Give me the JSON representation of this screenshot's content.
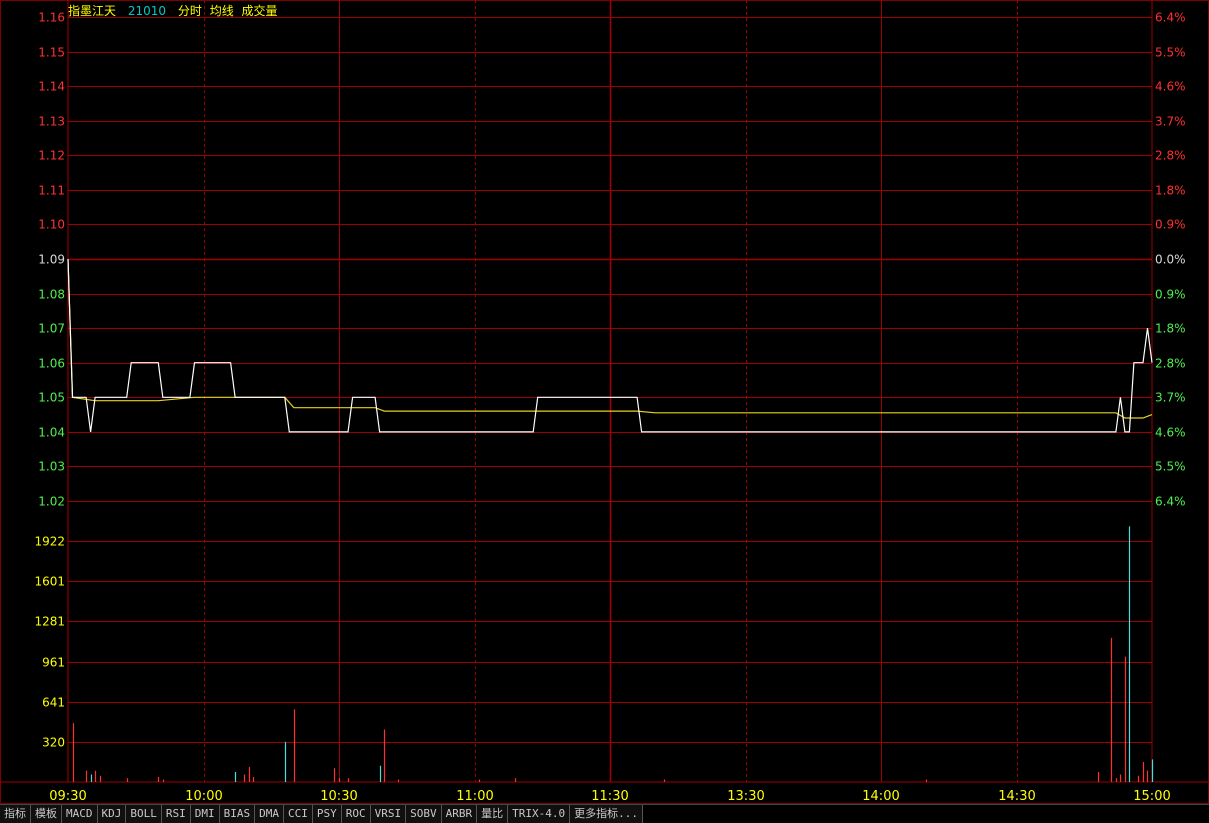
{
  "header": {
    "name": "指墨江天",
    "code": "21010",
    "labels": [
      "分时",
      "均线",
      "成交量"
    ],
    "colors": {
      "name": "#ffff00",
      "code": "#00c8c8",
      "labels": "#ffff00"
    }
  },
  "colors": {
    "background": "#000000",
    "grid": "#a00000",
    "up": "#ff3030",
    "down": "#4ef04e",
    "flat": "#d8d8d8",
    "price_line": "#ffffff",
    "avg_line": "#e6d21e",
    "volume_label": "#ffff00",
    "time_label": "#ffff00",
    "vol_up": "#ff3030",
    "vol_down": "#40e0e0"
  },
  "chart_data": {
    "type": "line",
    "prev_close": 1.09,
    "price_axis": {
      "ticks": [
        1.16,
        1.15,
        1.14,
        1.13,
        1.12,
        1.11,
        1.1,
        1.09,
        1.08,
        1.07,
        1.06,
        1.05,
        1.04,
        1.03,
        1.02
      ],
      "tick_labels": [
        "1.16",
        "1.15",
        "1.14",
        "1.13",
        "1.12",
        "1.11",
        "1.10",
        "1.09",
        "1.08",
        "1.07",
        "1.06",
        "1.05",
        "1.04",
        "1.03",
        "1.02"
      ],
      "ylim": [
        1.02,
        1.16
      ]
    },
    "percent_axis": {
      "tick_labels": [
        "6.4%",
        "5.5%",
        "4.6%",
        "3.7%",
        "2.8%",
        "1.8%",
        "0.9%",
        "0.0%",
        "0.9%",
        "1.8%",
        "2.8%",
        "3.7%",
        "4.6%",
        "5.5%",
        "6.4%"
      ]
    },
    "volume_axis": {
      "tick_labels": [
        "1922",
        "1601",
        "1281",
        "961",
        "641",
        "320"
      ],
      "ticks": [
        1922,
        1601,
        1281,
        961,
        641,
        320
      ],
      "ylim": [
        0,
        2242
      ]
    },
    "time_axis": {
      "tick_labels": [
        "09:30",
        "10:00",
        "10:30",
        "11:00",
        "11:30",
        "13:30",
        "14:00",
        "14:30",
        "15:00"
      ],
      "tick_minutes": [
        0,
        30,
        60,
        90,
        120,
        150,
        180,
        210,
        240
      ],
      "total_minutes": 240
    },
    "series": [
      {
        "key": "price",
        "points": [
          [
            0,
            1.09
          ],
          [
            1,
            1.05
          ],
          [
            4,
            1.05
          ],
          [
            5,
            1.04
          ],
          [
            6,
            1.05
          ],
          [
            13,
            1.05
          ],
          [
            14,
            1.06
          ],
          [
            20,
            1.06
          ],
          [
            21,
            1.05
          ],
          [
            27,
            1.05
          ],
          [
            28,
            1.06
          ],
          [
            36,
            1.06
          ],
          [
            37,
            1.05
          ],
          [
            48,
            1.05
          ],
          [
            49,
            1.04
          ],
          [
            62,
            1.04
          ],
          [
            63,
            1.05
          ],
          [
            68,
            1.05
          ],
          [
            69,
            1.04
          ],
          [
            103,
            1.04
          ],
          [
            104,
            1.05
          ],
          [
            126,
            1.05
          ],
          [
            127,
            1.04
          ],
          [
            232,
            1.04
          ],
          [
            233,
            1.05
          ],
          [
            234,
            1.04
          ],
          [
            235,
            1.04
          ],
          [
            236,
            1.06
          ],
          [
            238,
            1.06
          ],
          [
            239,
            1.07
          ],
          [
            240,
            1.06
          ]
        ]
      },
      {
        "key": "avg",
        "points": [
          [
            0,
            1.09
          ],
          [
            1,
            1.05
          ],
          [
            6,
            1.049
          ],
          [
            20,
            1.049
          ],
          [
            28,
            1.05
          ],
          [
            48,
            1.05
          ],
          [
            50,
            1.047
          ],
          [
            68,
            1.047
          ],
          [
            70,
            1.046
          ],
          [
            104,
            1.046
          ],
          [
            126,
            1.046
          ],
          [
            130,
            1.0455
          ],
          [
            232,
            1.0455
          ],
          [
            234,
            1.044
          ],
          [
            238,
            1.044
          ],
          [
            240,
            1.045
          ]
        ]
      }
    ],
    "volume": [
      [
        1,
        470,
        "up"
      ],
      [
        4,
        90,
        "up"
      ],
      [
        5,
        60,
        "down"
      ],
      [
        6,
        90,
        "up"
      ],
      [
        7,
        50,
        "up"
      ],
      [
        13,
        30,
        "up"
      ],
      [
        20,
        40,
        "up"
      ],
      [
        21,
        20,
        "up"
      ],
      [
        37,
        80,
        "down"
      ],
      [
        39,
        60,
        "up"
      ],
      [
        40,
        120,
        "up"
      ],
      [
        41,
        40,
        "up"
      ],
      [
        48,
        320,
        "down"
      ],
      [
        50,
        580,
        "up"
      ],
      [
        59,
        110,
        "up"
      ],
      [
        60,
        30,
        "up"
      ],
      [
        62,
        30,
        "up"
      ],
      [
        69,
        130,
        "down"
      ],
      [
        70,
        420,
        "up"
      ],
      [
        73,
        20,
        "up"
      ],
      [
        91,
        20,
        "up"
      ],
      [
        99,
        30,
        "up"
      ],
      [
        132,
        20,
        "up"
      ],
      [
        190,
        20,
        "up"
      ],
      [
        228,
        80,
        "up"
      ],
      [
        231,
        1150,
        "up"
      ],
      [
        232,
        30,
        "up"
      ],
      [
        233,
        60,
        "up"
      ],
      [
        234,
        1000,
        "up"
      ],
      [
        235,
        2040,
        "down"
      ],
      [
        237,
        50,
        "up"
      ],
      [
        238,
        160,
        "up"
      ],
      [
        239,
        90,
        "up"
      ],
      [
        240,
        180,
        "down"
      ]
    ]
  },
  "bottom_tabs": [
    "指标",
    "模板",
    "MACD",
    "KDJ",
    "BOLL",
    "RSI",
    "DMI",
    "BIAS",
    "DMA",
    "CCI",
    "PSY",
    "ROC",
    "VRSI",
    "SOBV",
    "ARBR",
    "量比",
    "TRIX-4.0",
    "更多指标..."
  ]
}
